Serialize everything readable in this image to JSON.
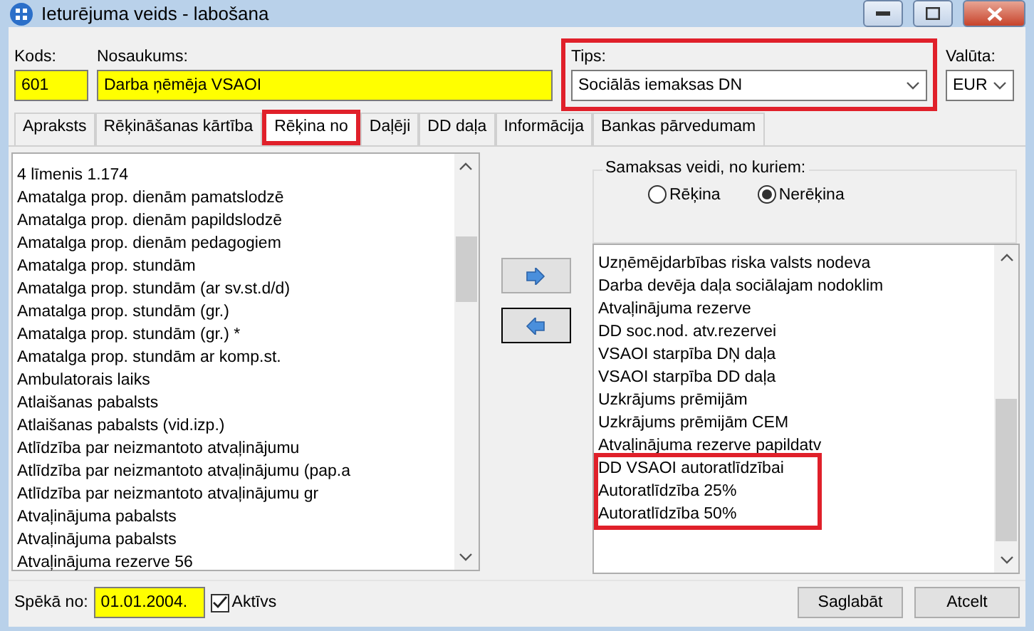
{
  "window": {
    "title": "Ieturējuma veids - labošana"
  },
  "header": {
    "code": {
      "label": "Kods:",
      "value": "601"
    },
    "name": {
      "label": "Nosaukums:",
      "value": "Darba ņēmēja VSAOI"
    },
    "type": {
      "label": "Tips:",
      "value": "Sociālās iemaksas DN",
      "highlighted": true
    },
    "currency": {
      "label": "Valūta:",
      "value": "EUR"
    }
  },
  "tabs": [
    {
      "label": "Apraksts",
      "selected": false,
      "highlighted": false
    },
    {
      "label": "Rēķināšanas kārtība",
      "selected": false,
      "highlighted": false
    },
    {
      "label": "Rēķina no",
      "selected": true,
      "highlighted": true
    },
    {
      "label": "Daļēji",
      "selected": false,
      "highlighted": false
    },
    {
      "label": "DD daļa",
      "selected": false,
      "highlighted": false
    },
    {
      "label": "Informācija",
      "selected": false,
      "highlighted": false
    },
    {
      "label": "Bankas pārvedumam",
      "selected": false,
      "highlighted": false
    }
  ],
  "available_list": [
    "4 līmenis 1.174",
    "Amatalga prop. dienām pamatslodzē",
    "Amatalga prop. dienām papildslodzē",
    "Amatalga prop. dienām pedagogiem",
    "Amatalga prop. stundām",
    "Amatalga prop. stundām (ar sv.st.d/d)",
    "Amatalga prop. stundām (gr.)",
    "Amatalga prop. stundām (gr.) *",
    "Amatalga prop. stundām ar komp.st.",
    "Ambulatorais laiks",
    "Atlaišanas pabalsts",
    "Atlaišanas pabalsts (vid.izp.)",
    "Atlīdzība par neizmantoto atvaļinājumu",
    "Atlīdzība par neizmantoto atvaļinājumu (pap.a",
    "Atlīdzība par neizmantoto atvaļinājumu gr",
    "Atvaļinājuma  pabalsts",
    "Atvaļinājuma  pabalsts",
    "Atvaļinājuma rezerve 56"
  ],
  "mode": {
    "label": "Samaksas veidi, no kuriem:",
    "options": [
      {
        "label": "Rēķina",
        "selected": false
      },
      {
        "label": "Nerēķina",
        "selected": true
      }
    ]
  },
  "selected_list": [
    {
      "label": "Uzņēmējdarbības riska valsts nodeva",
      "highlighted": false
    },
    {
      "label": "Darba devēja daļa sociālajam nodoklim",
      "highlighted": false
    },
    {
      "label": "Atvaļinājuma rezerve",
      "highlighted": false
    },
    {
      "label": "DD soc.nod. atv.rezervei",
      "highlighted": false
    },
    {
      "label": "VSAOI starpība DŅ daļa",
      "highlighted": false
    },
    {
      "label": "VSAOI starpība DD daļa",
      "highlighted": false
    },
    {
      "label": "Uzkrājums prēmijām",
      "highlighted": false
    },
    {
      "label": "Uzkrājums prēmijām CEM",
      "highlighted": false
    },
    {
      "label": "Atvaļinājuma rezerve papildatv",
      "highlighted": false
    },
    {
      "label": "DD VSAOI autoratlīdzībai",
      "highlighted": true
    },
    {
      "label": "Autoratlīdzība 25%",
      "highlighted": true
    },
    {
      "label": "Autoratlīdzība 50%",
      "highlighted": true
    }
  ],
  "footer": {
    "valid_from": {
      "label": "Spēkā no:",
      "value": "01.01.2004."
    },
    "active": {
      "label": "Aktīvs",
      "checked": true
    },
    "buttons": [
      "Saglabāt",
      "Atcelt"
    ]
  }
}
